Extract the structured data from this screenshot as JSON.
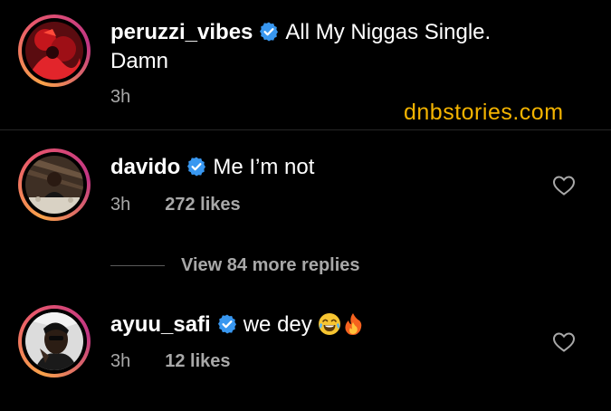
{
  "watermark": "dnbstories.com",
  "comments": [
    {
      "username": "peruzzi_vibes",
      "verified": true,
      "text": "All My Niggas Single.",
      "text_line2": "Damn",
      "time": "3h"
    },
    {
      "username": "davido",
      "verified": true,
      "text": "Me I’m not",
      "time": "3h",
      "likes": "272 likes"
    },
    {
      "username": "ayuu_safi",
      "verified": true,
      "text": "we dey",
      "emojis": [
        "joy-emoji",
        "fire-emoji"
      ],
      "time": "3h",
      "likes": "12 likes"
    }
  ],
  "replies": {
    "label": "View 84 more replies"
  },
  "icons": {
    "verified": "verified-badge-icon",
    "like": "heart-outline-icon"
  },
  "colors": {
    "background": "#000000",
    "text": "#ffffff",
    "secondary_text": "#a8a8a8",
    "verified": "#3897f0",
    "watermark": "#f4b400",
    "divider": "#262626"
  }
}
